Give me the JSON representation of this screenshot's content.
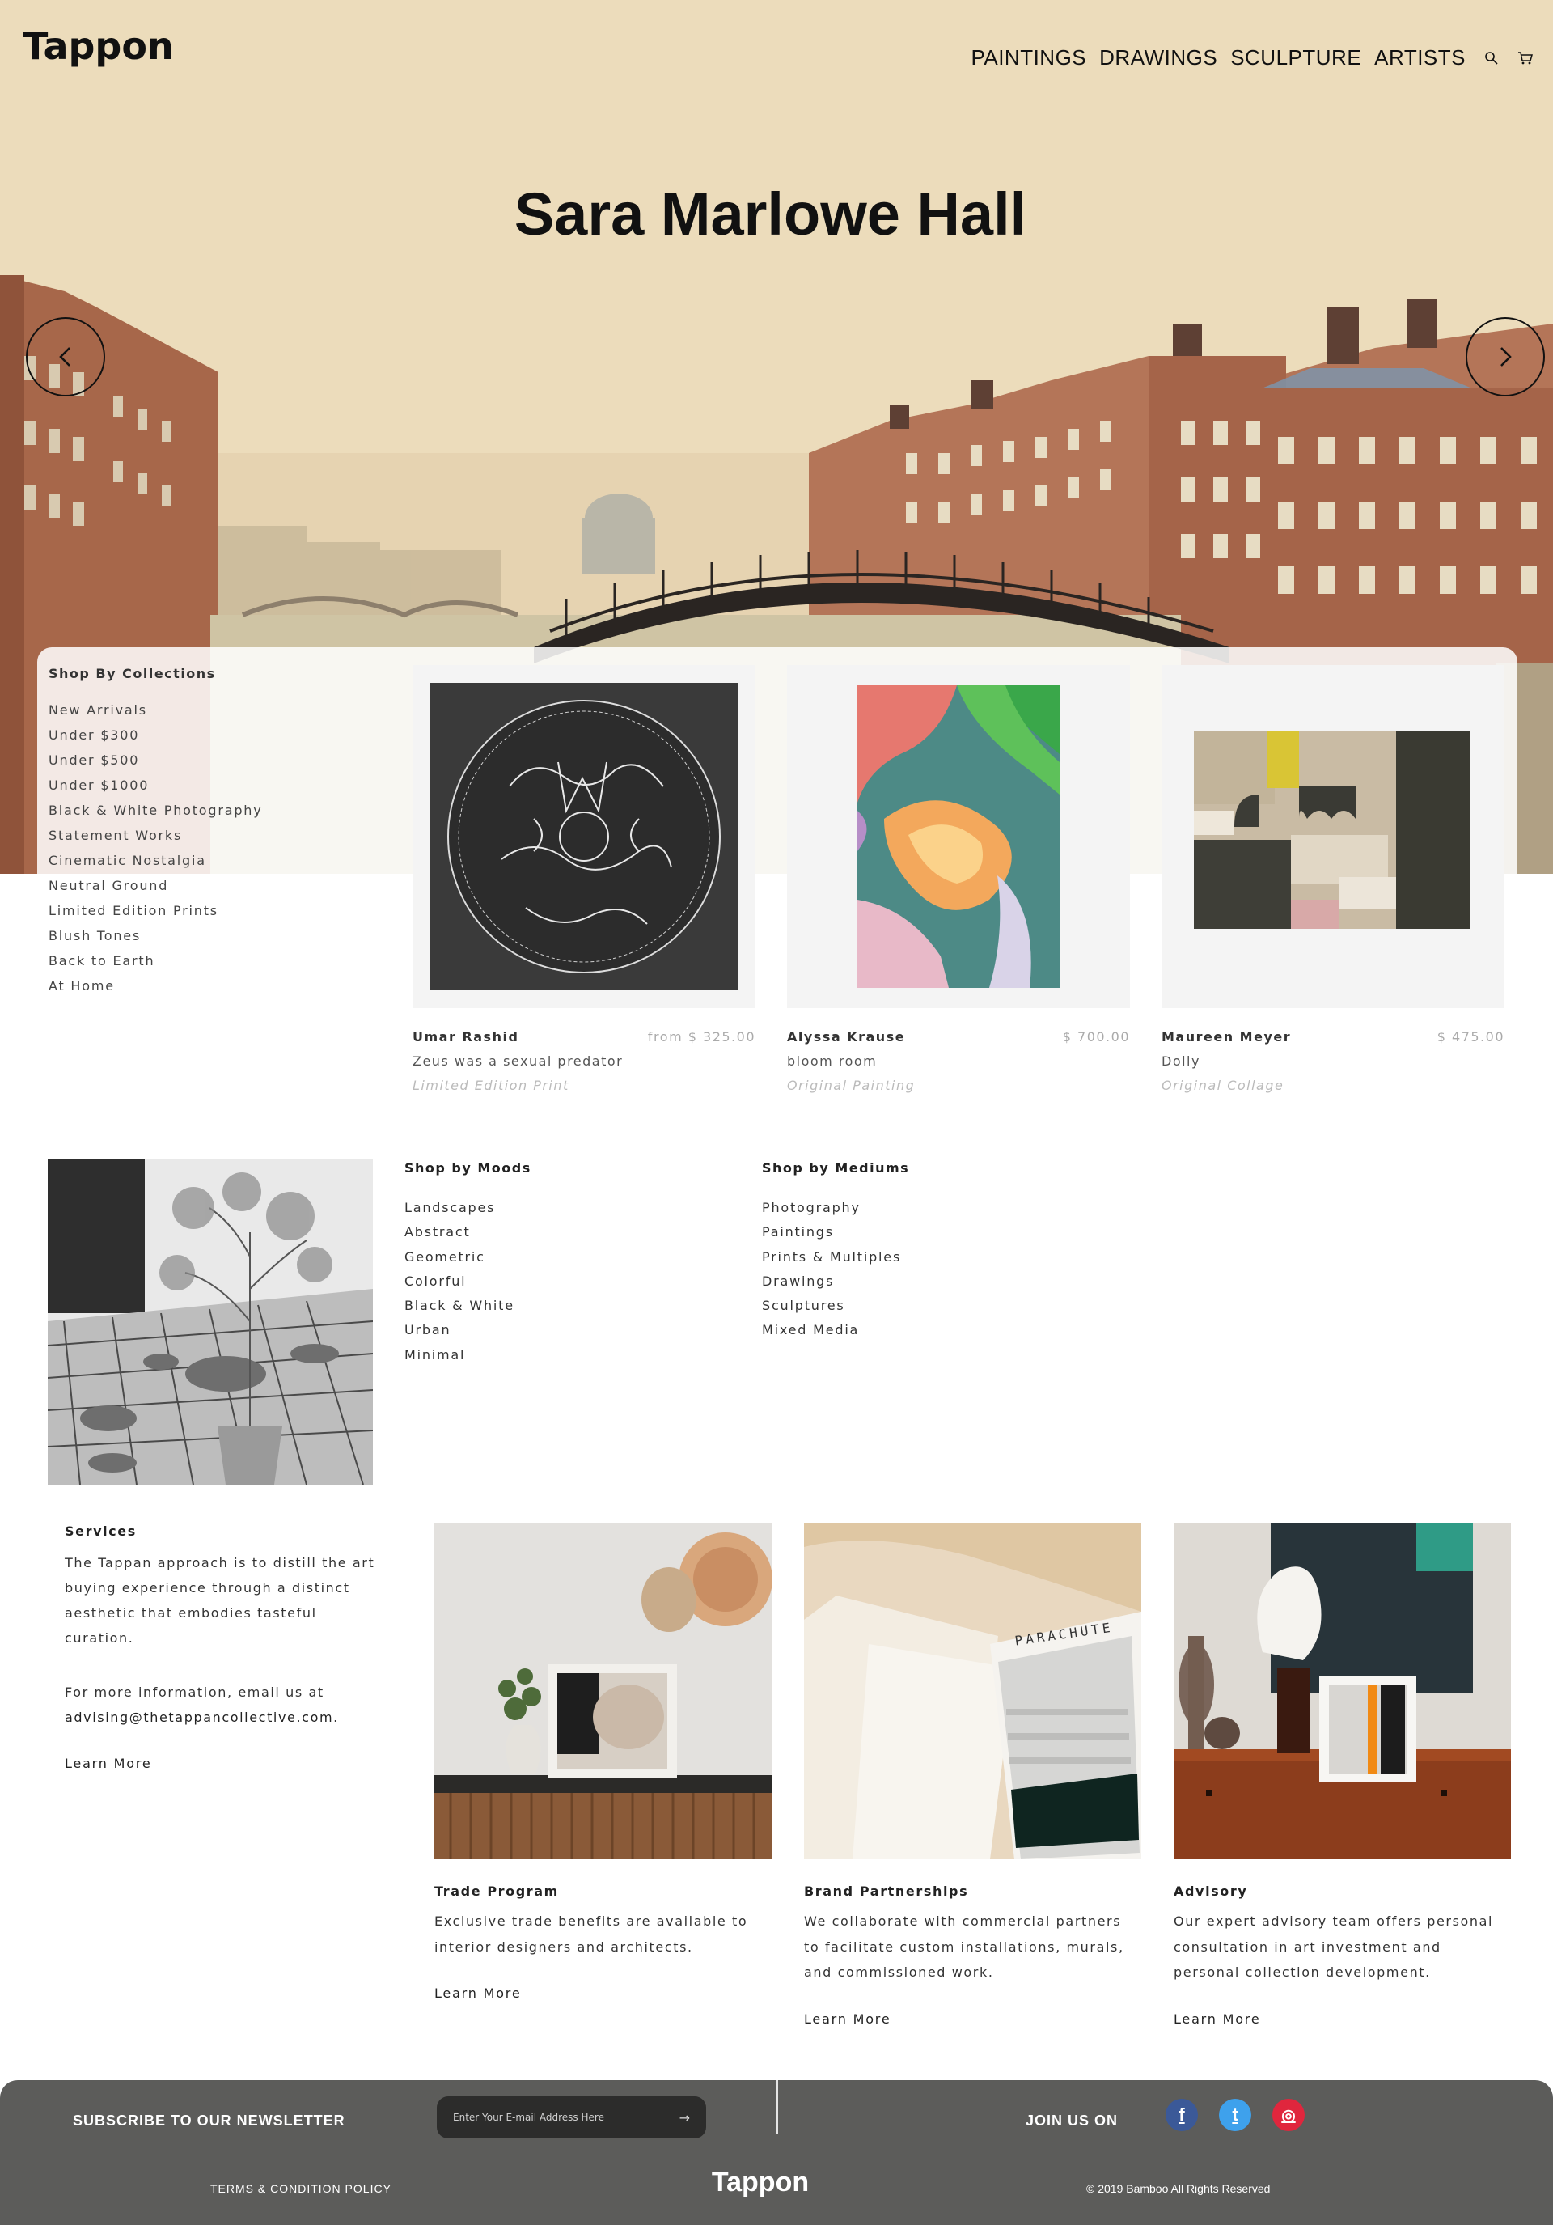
{
  "header": {
    "logo": "Tappon",
    "nav": [
      "PAINTINGS",
      "DRAWINGS",
      "SCULPTURE",
      "ARTISTS"
    ],
    "icons": [
      "search-icon",
      "cart-icon"
    ]
  },
  "hero": {
    "title": "Sara Marlowe Hall",
    "prev_icon": "chevron-left-icon",
    "next_icon": "chevron-right-icon"
  },
  "collections": {
    "heading": "Shop By Collections",
    "items": [
      "New Arrivals",
      "Under $300",
      "Under $500",
      "Under $1000",
      "Black & White Photography",
      "Statement Works",
      "Cinematic Nostalgia",
      "Neutral Ground",
      "Limited Edition Prints",
      "Blush Tones",
      "Back to Earth",
      "At Home"
    ]
  },
  "products": [
    {
      "artist": "Umar Rashid",
      "price": "from $ 325.00",
      "title": "Zeus was a sexual predator",
      "type": "Limited Edition Print"
    },
    {
      "artist": "Alyssa Krause",
      "price": "$ 700.00",
      "title": "bloom room",
      "type": "Original Painting"
    },
    {
      "artist": "Maureen Meyer",
      "price": "$ 475.00",
      "title": "Dolly",
      "type": "Original Collage"
    }
  ],
  "moods": {
    "heading": "Shop by Moods",
    "items": [
      "Landscapes",
      "Abstract",
      "Geometric",
      "Colorful",
      "Black & White",
      "Urban",
      "Minimal"
    ]
  },
  "mediums": {
    "heading": "Shop by Mediums",
    "items": [
      "Photography",
      "Paintings",
      "Prints & Multiples",
      "Drawings",
      "Sculptures",
      "Mixed Media"
    ]
  },
  "services": {
    "heading": "Services",
    "body": "The Tappan approach is to distill the art buying experience through a distinct aesthetic that embodies tasteful curation.",
    "contact_prefix": "For more information, email us at",
    "email": "advising@thetappancollective.com",
    "learn_more": "Learn More"
  },
  "service_cards": [
    {
      "title": "Trade Program",
      "body": "Exclusive trade benefits are available to interior designers and architects.",
      "learn_more": "Learn More",
      "label": ""
    },
    {
      "title": "Brand Partnerships",
      "body": "We collaborate with commercial partners to facilitate custom installations, murals, and commissioned work.",
      "learn_more": "Learn More",
      "label": "PARACHUTE"
    },
    {
      "title": "Advisory",
      "body": "Our expert advisory team offers personal consultation in art investment and personal collection development.",
      "learn_more": "Learn More",
      "label": ""
    }
  ],
  "footer": {
    "subscribe_label": "SUBSCRIBE TO OUR NEWSLETTER",
    "email_placeholder": "Enter Your E-mail Address Here",
    "submit_icon": "arrow-right-icon",
    "join_label": "JOIN US ON",
    "social": [
      {
        "name": "facebook-icon",
        "glyph": "f",
        "color": "#3b5998"
      },
      {
        "name": "twitter-icon",
        "glyph": "t",
        "color": "#3ea1ec"
      },
      {
        "name": "instagram-icon",
        "glyph": "◎",
        "color": "#e0263d"
      }
    ],
    "terms": "TERMS & CONDITION POLICY",
    "logo": "Tappon",
    "copyright": "© 2019 Bamboo All Rights Reserved"
  },
  "colors": {
    "hero_bg": "#ecdcbb",
    "footer_bg": "#5c5c5a",
    "text": "#222222"
  }
}
